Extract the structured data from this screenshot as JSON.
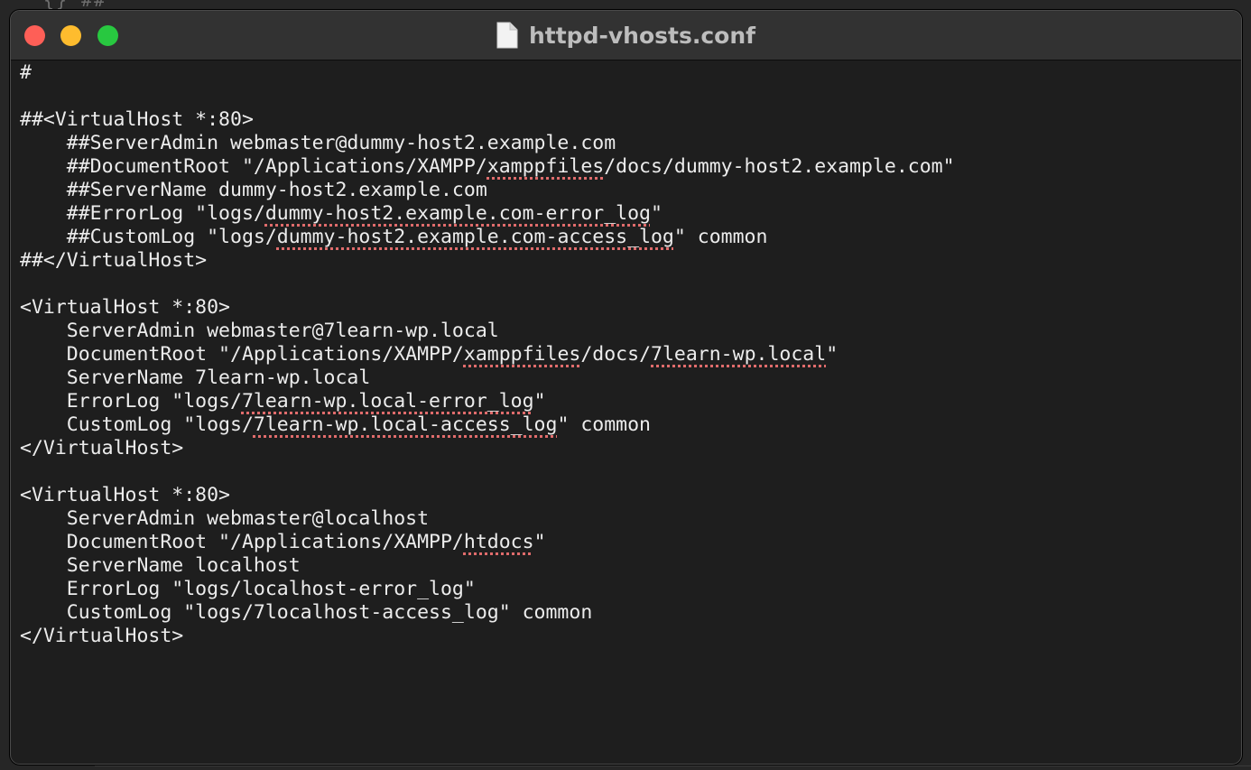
{
  "background": {
    "glyphs": "{}  ##"
  },
  "window": {
    "title": "httpd-vhosts.conf",
    "title_icon": "document-icon",
    "colors": {
      "close": "#fe5f57",
      "minimize": "#febc2e",
      "zoom": "#28c840",
      "editor_bg": "#1e1e1e",
      "text": "#ececec",
      "spellcheck_underline": "#e06c6c"
    }
  },
  "editor": {
    "lines": [
      [
        {
          "t": "#"
        }
      ],
      [],
      [
        {
          "t": "##<VirtualHost *:80>"
        }
      ],
      [
        {
          "t": "    ##ServerAdmin webmaster@dummy-host2.example.com"
        }
      ],
      [
        {
          "t": "    ##DocumentRoot \"/Applications/XAMPP/"
        },
        {
          "t": "xamppfiles",
          "s": true
        },
        {
          "t": "/docs/dummy-host2.example.com\""
        }
      ],
      [
        {
          "t": "    ##ServerName dummy-host2.example.com"
        }
      ],
      [
        {
          "t": "    ##ErrorLog \"logs/"
        },
        {
          "t": "dummy-host2.example.com-error_log",
          "s": true
        },
        {
          "t": "\""
        }
      ],
      [
        {
          "t": "    ##CustomLog \"logs/"
        },
        {
          "t": "dummy-host2.example.com-access_log",
          "s": true
        },
        {
          "t": "\" common"
        }
      ],
      [
        {
          "t": "##</VirtualHost>"
        }
      ],
      [],
      [
        {
          "t": "<VirtualHost *:80>"
        }
      ],
      [
        {
          "t": "    ServerAdmin webmaster@7learn-wp.local"
        }
      ],
      [
        {
          "t": "    DocumentRoot \"/Applications/XAMPP/"
        },
        {
          "t": "xamppfiles",
          "s": true
        },
        {
          "t": "/docs/"
        },
        {
          "t": "7learn-wp.local",
          "s": true
        },
        {
          "t": "\""
        }
      ],
      [
        {
          "t": "    ServerName 7learn-wp.local"
        }
      ],
      [
        {
          "t": "    ErrorLog \"logs/"
        },
        {
          "t": "7learn-wp.local-error_log",
          "s": true
        },
        {
          "t": "\""
        }
      ],
      [
        {
          "t": "    CustomLog \"logs/"
        },
        {
          "t": "7learn-wp.local-access_log",
          "s": true
        },
        {
          "t": "\" common"
        }
      ],
      [
        {
          "t": "</VirtualHost>"
        }
      ],
      [],
      [
        {
          "t": "<VirtualHost *:80>"
        }
      ],
      [
        {
          "t": "    ServerAdmin webmaster@localhost"
        }
      ],
      [
        {
          "t": "    DocumentRoot \"/Applications/XAMPP/"
        },
        {
          "t": "htdocs",
          "s": true
        },
        {
          "t": "\""
        }
      ],
      [
        {
          "t": "    ServerName localhost"
        }
      ],
      [
        {
          "t": "    ErrorLog \"logs/localhost-error_log\""
        }
      ],
      [
        {
          "t": "    CustomLog \"logs/7localhost-access_log\" common"
        }
      ],
      [
        {
          "t": "</VirtualHost>"
        }
      ]
    ]
  }
}
